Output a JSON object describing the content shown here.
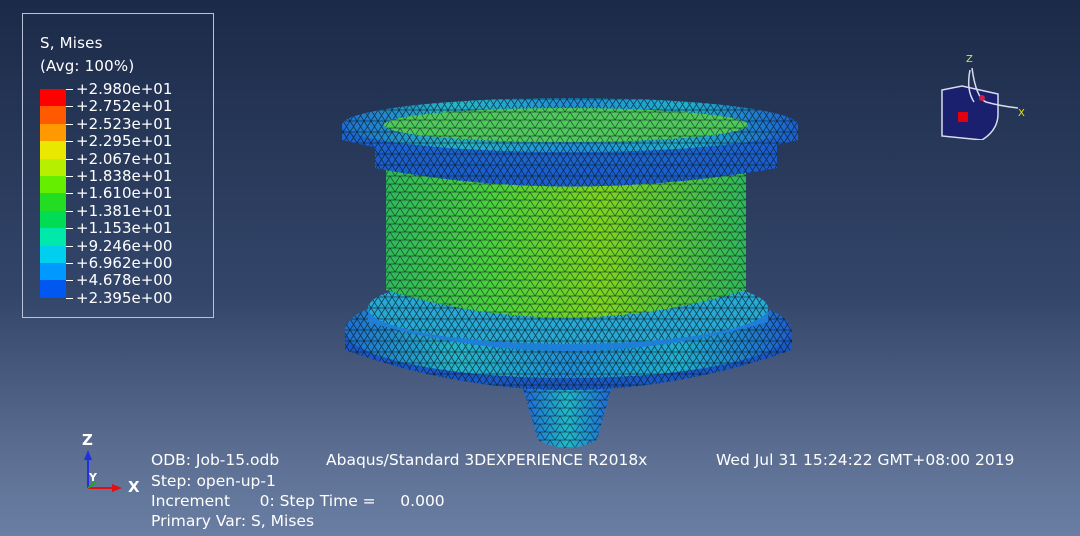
{
  "legend": {
    "title": "S, Mises",
    "avg": "(Avg: 100%)",
    "colors": [
      "#ff0000",
      "#ff5a00",
      "#ff9900",
      "#e8e800",
      "#b6f000",
      "#66ee00",
      "#22dd22",
      "#00dd55",
      "#00e8aa",
      "#00d0ee",
      "#0099ff",
      "#0058f0",
      "#0018e0"
    ],
    "values": [
      "+2.980e+01",
      "+2.752e+01",
      "+2.523e+01",
      "+2.295e+01",
      "+2.067e+01",
      "+1.838e+01",
      "+1.610e+01",
      "+1.381e+01",
      "+1.153e+01",
      "+9.246e+00",
      "+6.962e+00",
      "+4.678e+00",
      "+2.395e+00"
    ]
  },
  "info": {
    "odb": "ODB: Job-15.odb",
    "solver": "Abaqus/Standard 3DEXPERIENCE R2018x",
    "date": "Wed Jul 31 15:24:22 GMT+08:00 2019",
    "step": "Step: open-up-1",
    "increment": "Increment      0: Step Time =     0.000",
    "primary_var": "Primary Var: S, Mises"
  },
  "triad": {
    "z": "Z",
    "y": "Y",
    "x": "X"
  },
  "view_triad": {
    "z": "Z",
    "x": "X"
  }
}
